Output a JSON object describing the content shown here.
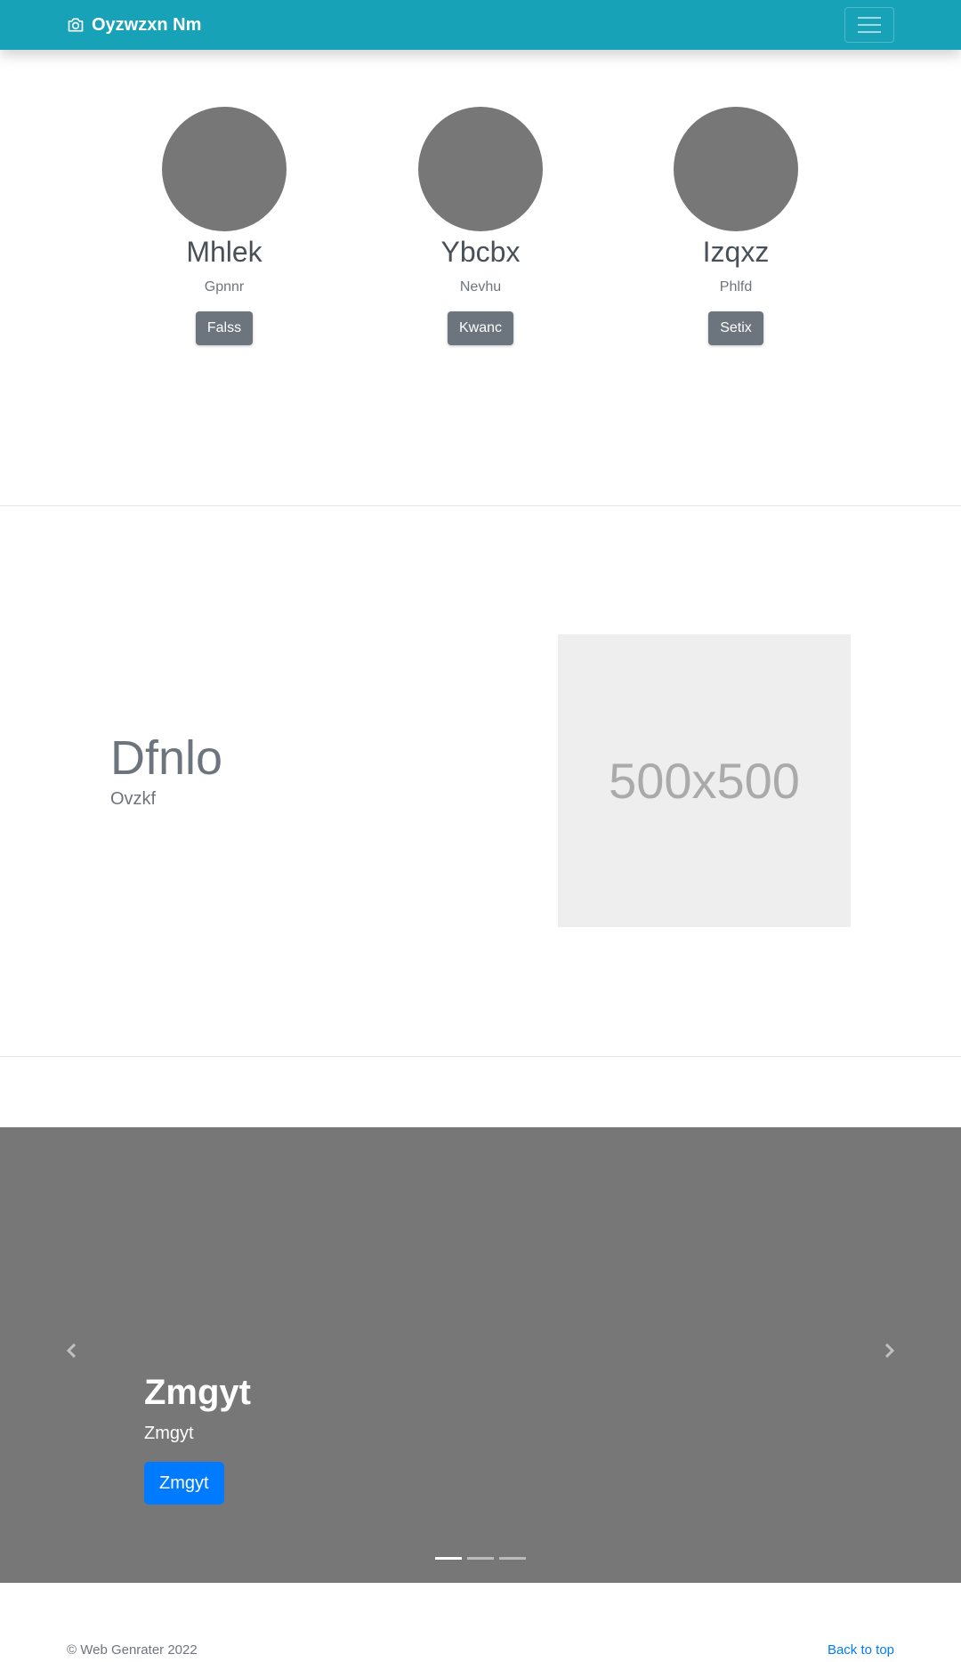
{
  "navbar": {
    "brand": "Oyzwzxn Nm",
    "brand_icon": "camera-icon",
    "toggler_icon": "hamburger-menu-icon",
    "background": "#17a2b8"
  },
  "team": [
    {
      "name": "Mhlek",
      "role": "Gpnnr",
      "button": "Falss"
    },
    {
      "name": "Ybcbx",
      "role": "Nevhu",
      "button": "Kwanc"
    },
    {
      "name": "Izqxz",
      "role": "Phlfd",
      "button": "Setix"
    }
  ],
  "feature": {
    "title": "Dfnlo",
    "subtitle": "Ovzkf",
    "image_label": "500x500"
  },
  "carousel": {
    "title": "Zmgyt",
    "text": "Zmgyt",
    "button": "Zmgyt",
    "prev_icon": "chevron-left-icon",
    "next_icon": "chevron-right-icon",
    "slides": 3,
    "active_slide": 1,
    "background": "#777777"
  },
  "footer": {
    "copyright": "© Web Genrater 2022",
    "back_to_top": "Back to top"
  }
}
